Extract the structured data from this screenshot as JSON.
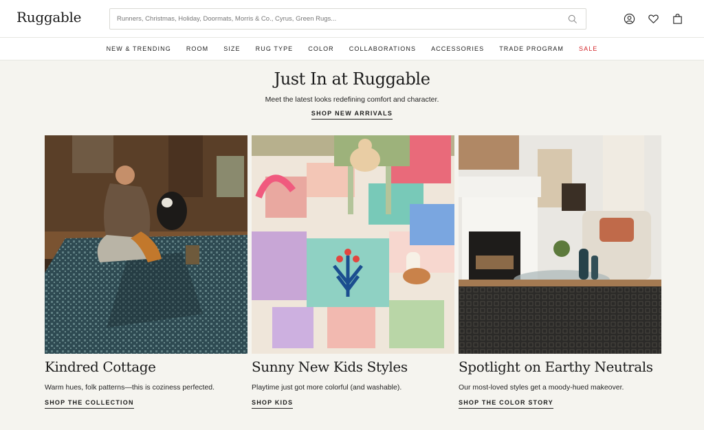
{
  "header": {
    "logo": "Ruggable",
    "search_placeholder": "Runners, Christmas, Holiday, Doormats, Morris & Co., Cyrus, Green Rugs...",
    "icons": [
      "account-icon",
      "heart-icon",
      "bag-icon"
    ]
  },
  "nav": {
    "items": [
      {
        "label": "NEW & TRENDING"
      },
      {
        "label": "ROOM"
      },
      {
        "label": "SIZE"
      },
      {
        "label": "RUG TYPE"
      },
      {
        "label": "COLOR"
      },
      {
        "label": "COLLABORATIONS"
      },
      {
        "label": "ACCESSORIES"
      },
      {
        "label": "TRADE PROGRAM"
      },
      {
        "label": "SALE",
        "color": "#d3262b"
      }
    ]
  },
  "hero": {
    "title": "Just In at Ruggable",
    "subtitle": "Meet the latest looks redefining comfort and character.",
    "cta": "SHOP NEW ARRIVALS"
  },
  "cards": [
    {
      "title": "Kindred Cottage",
      "description": "Warm hues, folk patterns—this is coziness perfected.",
      "cta": "SHOP THE COLLECTION"
    },
    {
      "title": "Sunny New Kids Styles",
      "description": "Playtime just got more colorful (and washable).",
      "cta": "SHOP KIDS"
    },
    {
      "title": "Spotlight on Earthy Neutrals",
      "description": "Our most-loved styles get a moody-hued makeover.",
      "cta": "SHOP THE COLOR STORY"
    }
  ],
  "colors": {
    "background": "#f5f4ef",
    "sale": "#d3262b",
    "text": "#1d1d1d"
  }
}
